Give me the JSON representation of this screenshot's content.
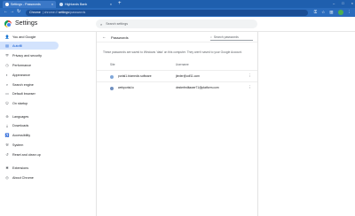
{
  "tabs": [
    {
      "title": "Settings - Passwords",
      "active": true
    },
    {
      "title": "Highlands Bank",
      "active": false
    }
  ],
  "tab_new": "+",
  "tab_close": "×",
  "window_controls": {
    "minimize": "–",
    "maximize": "□",
    "close": "×"
  },
  "omnibox": {
    "origin": "Chrome",
    "scheme": "| chrome://",
    "host": "settings",
    "path": "/passwords"
  },
  "header": {
    "title": "Settings",
    "search_placeholder": "Search settings"
  },
  "sidebar": {
    "items": [
      {
        "label": "You and Google",
        "icon": "person-icon",
        "glyph": "👤"
      },
      {
        "label": "Autofill",
        "icon": "autofill-icon",
        "glyph": "▤",
        "active": true
      },
      {
        "label": "Privacy and security",
        "icon": "shield-icon",
        "glyph": "⛨"
      },
      {
        "label": "Performance",
        "icon": "speedometer-icon",
        "glyph": "◷"
      },
      {
        "label": "Appearance",
        "icon": "palette-icon",
        "glyph": "◐"
      },
      {
        "label": "Search engine",
        "icon": "search-icon",
        "glyph": "⌕"
      },
      {
        "label": "Default browser",
        "icon": "browser-icon",
        "glyph": "▭"
      },
      {
        "label": "On startup",
        "icon": "power-icon",
        "glyph": "⏻"
      },
      {
        "label": "Languages",
        "icon": "globe-icon",
        "glyph": "⊕"
      },
      {
        "label": "Downloads",
        "icon": "download-icon",
        "glyph": "⤓"
      },
      {
        "label": "Accessibility",
        "icon": "accessibility-icon",
        "glyph": "♿"
      },
      {
        "label": "System",
        "icon": "wrench-icon",
        "glyph": "⚒"
      },
      {
        "label": "Reset and clean up",
        "icon": "reset-icon",
        "glyph": "↺"
      },
      {
        "label": "Extensions",
        "icon": "puzzle-icon",
        "glyph": "✱"
      },
      {
        "label": "About Chrome",
        "icon": "chrome-icon",
        "glyph": "◎"
      }
    ]
  },
  "passwords": {
    "title": "Passwords",
    "search_placeholder": "Search passwords",
    "description": "These passwords are saved to Windows 'data' on this computer. They aren't saved to your Google Account.",
    "columns": {
      "site": "Site",
      "username": "Username"
    },
    "rows": [
      {
        "site": "portal1.biomedix.software",
        "username": "jlexler@cdf11.com",
        "favicon_color": "#7fa7d9"
      },
      {
        "site": "webportal.io",
        "username": "desterfeditawer71@platform.com",
        "favicon_color": "#6f8fbf"
      }
    ]
  }
}
